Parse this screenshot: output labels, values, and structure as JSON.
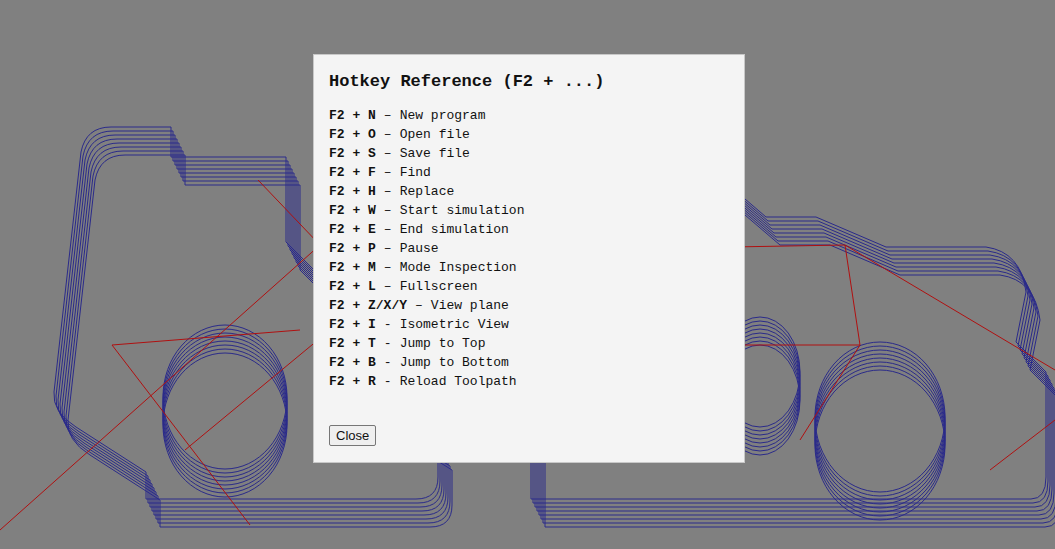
{
  "dialog": {
    "title": "Hotkey Reference (F2 + ...)",
    "hotkeys": [
      {
        "keys": "F2 + N",
        "separator": "–",
        "action": "New program"
      },
      {
        "keys": "F2 + O",
        "separator": "–",
        "action": "Open file"
      },
      {
        "keys": "F2 + S",
        "separator": "–",
        "action": "Save file"
      },
      {
        "keys": "F2 + F",
        "separator": "–",
        "action": "Find"
      },
      {
        "keys": "F2 + H",
        "separator": "–",
        "action": "Replace"
      },
      {
        "keys": "F2 + W",
        "separator": "–",
        "action": "Start simulation"
      },
      {
        "keys": "F2 + E",
        "separator": "–",
        "action": "End simulation"
      },
      {
        "keys": "F2 + P",
        "separator": "–",
        "action": "Pause"
      },
      {
        "keys": "F2 + M",
        "separator": "–",
        "action": "Mode Inspection"
      },
      {
        "keys": "F2 + L",
        "separator": "–",
        "action": "Fullscreen"
      },
      {
        "keys": "F2 + Z/X/Y",
        "separator": "–",
        "action": "View plane"
      },
      {
        "keys": "F2 + I",
        "separator": "-",
        "action": "Isometric View"
      },
      {
        "keys": "F2 + T",
        "separator": "-",
        "action": "Jump to Top"
      },
      {
        "keys": "F2 + B",
        "separator": "-",
        "action": "Jump to Bottom"
      },
      {
        "keys": "F2 + R",
        "separator": "-",
        "action": "Reload Toolpath"
      }
    ],
    "buttons": [
      "Close"
    ]
  }
}
